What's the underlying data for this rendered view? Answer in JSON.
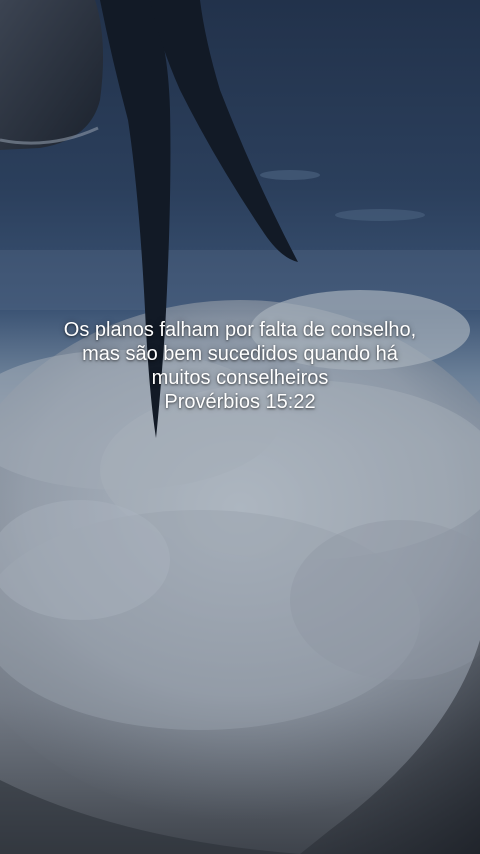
{
  "quote": {
    "lines": [
      "Os planos falham por falta de conselho,",
      "mas são bem sucedidos quando há",
      "muitos conselheiros"
    ],
    "reference": "Provérbios 15:22"
  },
  "scene": {
    "sky_color": "#2b3f5c",
    "cloud_color": "#9aa3ae",
    "propeller_color": "#121a26",
    "text_color": "#ffffff"
  }
}
